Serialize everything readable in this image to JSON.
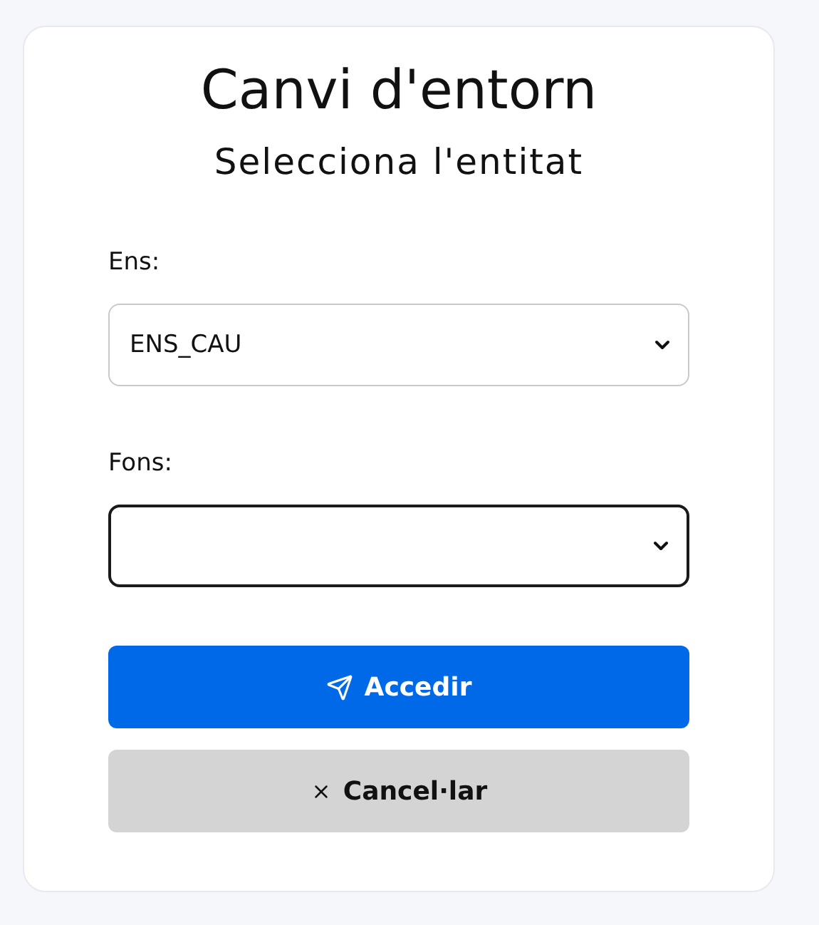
{
  "title": "Canvi d'entorn",
  "subtitle": "Selecciona l'entitat",
  "fields": [
    {
      "label": "Ens:",
      "value": "ENS_CAU",
      "focused": false
    },
    {
      "label": "Fons:",
      "focused": true
    }
  ],
  "buttons": [
    {
      "kind": "primary",
      "label": "Accedir"
    },
    {
      "kind": "secondary",
      "label": "Cancel·lar"
    }
  ]
}
